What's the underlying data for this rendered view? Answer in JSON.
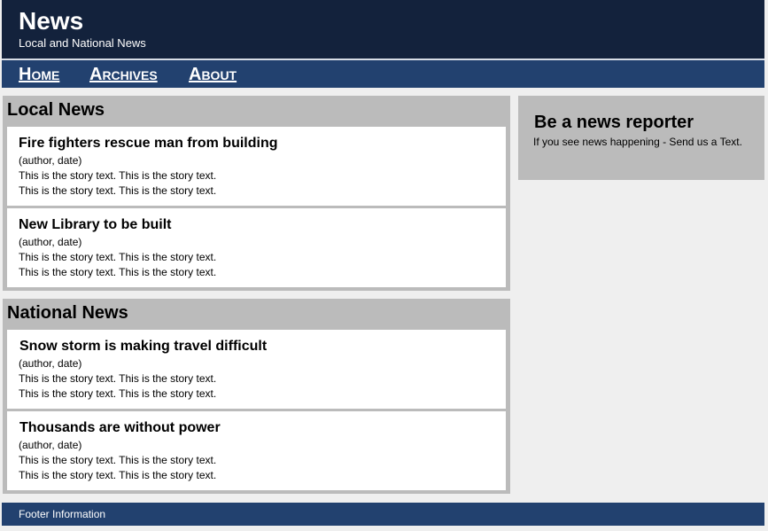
{
  "header": {
    "title": "News",
    "subtitle": "Local and National News"
  },
  "nav": {
    "home": "Home",
    "archives": "Archives",
    "about": "About"
  },
  "sections": {
    "local": {
      "title": "Local News",
      "stories": [
        {
          "title": "Fire fighters rescue man from building",
          "meta": "(author, date)",
          "text1": "This is the story text. This is the story text.",
          "text2": "This is the story text. This is the story text."
        },
        {
          "title": "New Library to be built",
          "meta": "(author, date)",
          "text1": "This is the story text. This is the story text.",
          "text2": "This is the story text. This is the story text."
        }
      ]
    },
    "national": {
      "title": "National News",
      "stories": [
        {
          "title": "Snow storm is making travel difficult",
          "meta": "(author, date)",
          "text1": "This is the story text. This is the story text.",
          "text2": "This is the story text. This is the story text."
        },
        {
          "title": "Thousands are without power",
          "meta": "(author, date)",
          "text1": "This is the story text. This is the story text.",
          "text2": "This is the story text. This is the story text."
        }
      ]
    }
  },
  "sidebar": {
    "title": "Be a news reporter",
    "text": "If you see news happening - Send us a Text."
  },
  "footer": {
    "text": "Footer Information"
  },
  "colors": {
    "header_bg": "#13223c",
    "nav_bg": "#22416f",
    "section_bg": "#bbbbbb",
    "page_bg": "#efefef"
  }
}
